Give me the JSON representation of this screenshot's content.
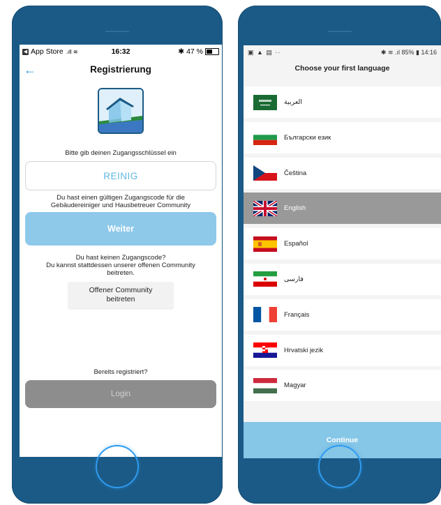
{
  "left": {
    "status": {
      "carrier": "App Store",
      "time": "16:32",
      "bt": "✱",
      "battery": "47 %",
      "battery_level": 0.47
    },
    "nav": {
      "title": "Registrierung",
      "back": "←"
    },
    "prompt": "Bitte gib deinen Zugangsschlüssel ein",
    "code_input": {
      "value": "REINIG"
    },
    "info_lines": [
      "Du hast einen gültigen Zugangscode für die",
      "Gebäudereiniger und Hausbetreuer Community"
    ],
    "next_label": "Weiter",
    "no_code_lines": [
      "Du hast keinen Zugangscode?",
      "Du kannst stattdessen unserer offenen Community",
      "beitreten."
    ],
    "open_community_lines": [
      "Offener Community",
      "beitreten"
    ],
    "already_registered": "Bereits registriert?",
    "login_label": "Login"
  },
  "right": {
    "status": {
      "left": "▣ ▲ ▤ ··",
      "right": "✱ ≋ .ıl 85% ▮ 14:16"
    },
    "title": "Choose your first language",
    "languages": [
      {
        "label": "العربية",
        "flag": "saudi-arabia"
      },
      {
        "label": "Български език",
        "flag": "bulgaria"
      },
      {
        "label": "Čeština",
        "flag": "czech-republic"
      },
      {
        "label": "English",
        "flag": "united-kingdom",
        "selected": true
      },
      {
        "label": "Español",
        "flag": "spain"
      },
      {
        "label": "فارسی",
        "flag": "iran"
      },
      {
        "label": "Français",
        "flag": "france"
      },
      {
        "label": "Hrvatski jezik",
        "flag": "croatia"
      },
      {
        "label": "Magyar",
        "flag": "hungary"
      }
    ],
    "continue_label": "Continue"
  },
  "colors": {
    "phone_frame": "#1b5a86",
    "accent": "#3a9ddd",
    "primary_button": "#8ec9ea",
    "login_button": "#8d8d8d",
    "continue_button": "#86c6e6",
    "selected_row": "#999999"
  }
}
